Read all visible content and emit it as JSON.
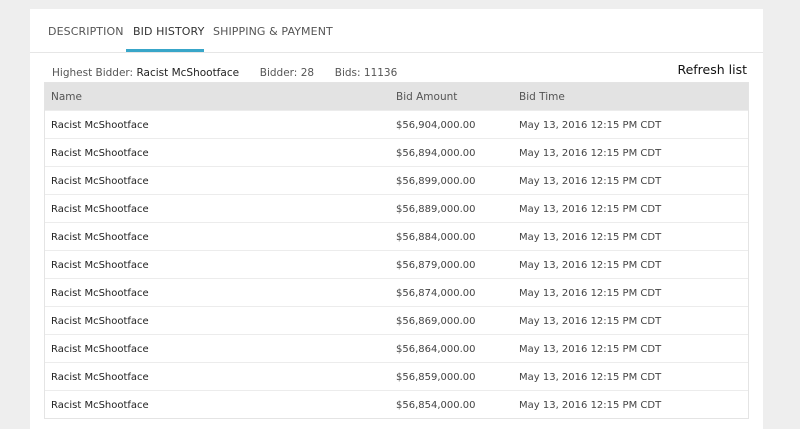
{
  "tabs": [
    {
      "label": "DESCRIPTION",
      "active": false
    },
    {
      "label": "BID HISTORY",
      "active": true
    },
    {
      "label": "SHIPPING & PAYMENT",
      "active": false
    }
  ],
  "summary": {
    "highest_bidder_label": "Highest Bidder:",
    "highest_bidder_value": "Racist McShootface",
    "bidder_label": "Bidder:",
    "bidder_value": "28",
    "bids_label": "Bids:",
    "bids_value": "11136"
  },
  "refresh_label": "Refresh list",
  "table": {
    "columns": [
      "Name",
      "Bid Amount",
      "Bid Time"
    ],
    "rows": [
      {
        "name": "Racist McShootface",
        "amount": "$56,904,000.00",
        "time": "May 13, 2016 12:15 PM CDT"
      },
      {
        "name": "Racist McShootface",
        "amount": "$56,894,000.00",
        "time": "May 13, 2016 12:15 PM CDT"
      },
      {
        "name": "Racist McShootface",
        "amount": "$56,899,000.00",
        "time": "May 13, 2016 12:15 PM CDT"
      },
      {
        "name": "Racist McShootface",
        "amount": "$56,889,000.00",
        "time": "May 13, 2016 12:15 PM CDT"
      },
      {
        "name": "Racist McShootface",
        "amount": "$56,884,000.00",
        "time": "May 13, 2016 12:15 PM CDT"
      },
      {
        "name": "Racist McShootface",
        "amount": "$56,879,000.00",
        "time": "May 13, 2016 12:15 PM CDT"
      },
      {
        "name": "Racist McShootface",
        "amount": "$56,874,000.00",
        "time": "May 13, 2016 12:15 PM CDT"
      },
      {
        "name": "Racist McShootface",
        "amount": "$56,869,000.00",
        "time": "May 13, 2016 12:15 PM CDT"
      },
      {
        "name": "Racist McShootface",
        "amount": "$56,864,000.00",
        "time": "May 13, 2016 12:15 PM CDT"
      },
      {
        "name": "Racist McShootface",
        "amount": "$56,859,000.00",
        "time": "May 13, 2016 12:15 PM CDT"
      },
      {
        "name": "Racist McShootface",
        "amount": "$56,854,000.00",
        "time": "May 13, 2016 12:15 PM CDT"
      }
    ]
  },
  "colors": {
    "accent": "#38a6c9",
    "page_background": "#eeeeee",
    "panel_background": "#ffffff",
    "header_background": "#e3e3e3"
  }
}
